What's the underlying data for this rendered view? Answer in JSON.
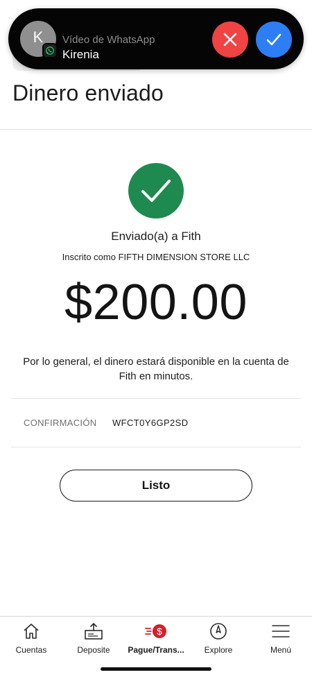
{
  "call_banner": {
    "avatar_initial": "K",
    "subtitle": "Vídeo de WhatsApp",
    "caller_name": "Kirenia",
    "decline_icon": "close-icon",
    "accept_icon": "check-icon",
    "decline_color": "#f04343",
    "accept_color": "#2d7ef4"
  },
  "page": {
    "title": "Dinero enviado",
    "success_icon": "check-circle-icon",
    "success_color": "#1f8a4f",
    "sent_to": "Enviado(a) a Fith",
    "enrolled_as": "Inscrito como FIFTH DIMENSION STORE LLC",
    "amount": "$200.00",
    "availability_note": "Por lo general, el dinero estará disponible en la cuenta de Fith en minutos.",
    "confirmation": {
      "label": "CONFIRMACIÓN",
      "value": "WFCT0Y6GP2SD"
    },
    "done_button": "Listo"
  },
  "bottom_nav": {
    "items": [
      {
        "label": "Cuentas",
        "icon": "house-icon",
        "active": false
      },
      {
        "label": "Deposite",
        "icon": "deposit-icon",
        "active": false
      },
      {
        "label": "Pague/Trans...",
        "icon": "send-money-icon",
        "active": true
      },
      {
        "label": "Explore",
        "icon": "compass-icon",
        "active": false
      },
      {
        "label": "Menú",
        "icon": "hamburger-icon",
        "active": false
      }
    ],
    "accent_color": "#d71e28"
  }
}
